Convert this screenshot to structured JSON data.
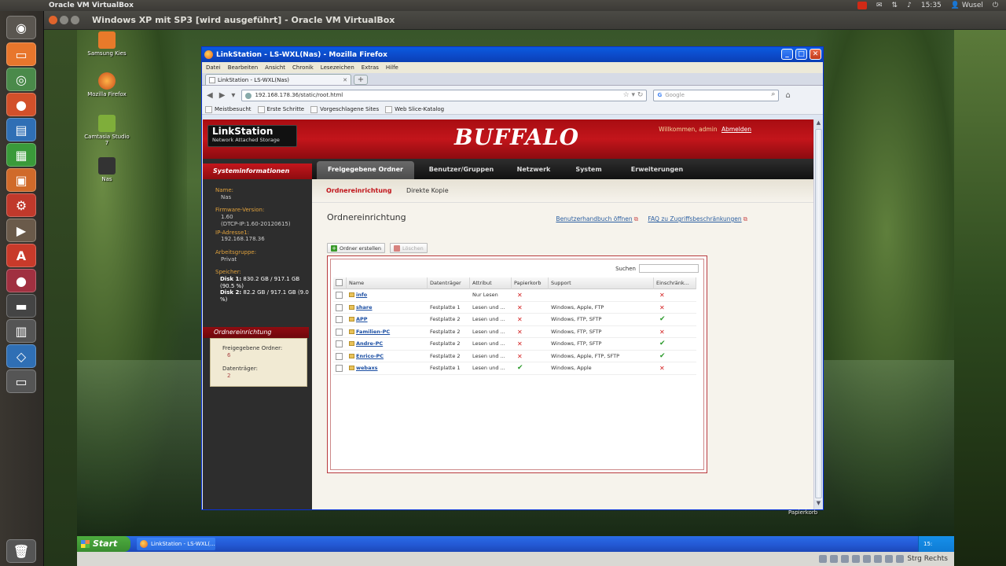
{
  "ubuntu_panel": {
    "app_title": "Oracle VM VirtualBox",
    "time": "15:35",
    "user": "Wusel"
  },
  "launcher": {
    "items": [
      "dash-icon",
      "files-icon",
      "chrome-icon",
      "firefox-icon",
      "writer-icon",
      "calc-icon",
      "impress-icon",
      "settings-icon",
      "app-icon",
      "software-icon",
      "terminal-icon",
      "clapper-icon",
      "virtualbox-icon",
      "window-icon",
      "trash-icon"
    ]
  },
  "vbox": {
    "window_title": "Windows XP mit SP3 [wird ausgeführt] - Oracle VM VirtualBox",
    "status_text": "Strg Rechts"
  },
  "desktop_icons": [
    {
      "label": "Samsung Kies"
    },
    {
      "label": "Mozilla Firefox"
    },
    {
      "label": "Camtasia Studio 7"
    },
    {
      "label": "Nas"
    }
  ],
  "firefox": {
    "window_title": "LinkStation - LS-WXL(Nas) - Mozilla Firefox",
    "menu": [
      "Datei",
      "Bearbeiten",
      "Ansicht",
      "Chronik",
      "Lesezeichen",
      "Extras",
      "Hilfe"
    ],
    "tab_title": "LinkStation - LS-WXL(Nas)",
    "url": "192.168.178.36/static/root.html",
    "search_placeholder": "Google",
    "bookmarks": [
      "Meistbesucht",
      "Erste Schritte",
      "Vorgeschlagene Sites",
      "Web Slice-Katalog"
    ]
  },
  "page": {
    "logo_line1": "LinkStation",
    "logo_line2": "Network Attached Storage",
    "brand": "BUFFALO",
    "welcome": "Willkommen, admin",
    "logout": "Abmelden",
    "nav_tabs": [
      "Freigegebene Ordner",
      "Benutzer/Gruppen",
      "Netzwerk",
      "System",
      "Erweiterungen"
    ],
    "subnav": [
      "Ordnereinrichtung",
      "Direkte Kopie"
    ],
    "sidebar": {
      "title": "Systeminformationen",
      "name_label": "Name:",
      "name_value": "Nas",
      "fw_label": "Firmware-Version:",
      "fw_value1": "1.60",
      "fw_value2": "(DTCP-IP:1.60-20120615)",
      "ip_label": "IP-Adresse1:",
      "ip_value": "192.168.178.36",
      "wg_label": "Arbeitsgruppe:",
      "wg_value": "Privat",
      "mem_label": "Speicher:",
      "disk1_bold": "Disk 1:",
      "disk1_value": "830.2 GB / 917.1 GB (90.5 %)",
      "disk2_bold": "Disk 2:",
      "disk2_value": "82.2 GB / 917.1 GB (9.0 %)",
      "section2_title": "Ordnereinrichtung",
      "shared_label": "Freigegebene Ordner:",
      "shared_value": "6",
      "drives_label": "Datenträger:",
      "drives_value": "2"
    },
    "title": "Ordnereinrichtung",
    "link_manual": "Benutzerhandbuch öffnen",
    "link_faq": "FAQ zu Zugriffsbeschränkungen",
    "btn_create": "Ordner erstellen",
    "btn_delete": "Löschen",
    "search_label": "Suchen",
    "columns": [
      "Name",
      "Datenträger",
      "Attribut",
      "Papierkorb",
      "Support",
      "Einschränk..."
    ],
    "rows": [
      {
        "name": "info",
        "drive": "",
        "attr": "Nur Lesen",
        "trash": "x",
        "support": "",
        "restrict": "x"
      },
      {
        "name": "share",
        "drive": "Festplatte 1",
        "attr": "Lesen und ...",
        "trash": "x",
        "support": "Windows, Apple, FTP",
        "restrict": "x"
      },
      {
        "name": "APP",
        "drive": "Festplatte 2",
        "attr": "Lesen und ...",
        "trash": "x",
        "support": "Windows, FTP, SFTP",
        "restrict": "ok"
      },
      {
        "name": "Familien-PC",
        "drive": "Festplatte 2",
        "attr": "Lesen und ...",
        "trash": "x",
        "support": "Windows, FTP, SFTP",
        "restrict": "x"
      },
      {
        "name": "Andre-PC",
        "drive": "Festplatte 2",
        "attr": "Lesen und ...",
        "trash": "x",
        "support": "Windows, FTP, SFTP",
        "restrict": "ok"
      },
      {
        "name": "Enrico-PC",
        "drive": "Festplatte 2",
        "attr": "Lesen und ...",
        "trash": "x",
        "support": "Windows, Apple, FTP, SFTP",
        "restrict": "ok"
      },
      {
        "name": "webaxs",
        "drive": "Festplatte 1",
        "attr": "Lesen und ...",
        "trash": "ok",
        "support": "Windows, Apple",
        "restrict": "x"
      }
    ]
  },
  "xp_taskbar": {
    "start": "Start",
    "firefox_task": "LinkStation - LS-WXL(...",
    "tray_time": "15:",
    "recycle_label": "Papierkorb"
  },
  "colors": {
    "buffalo_red": "#c3151b",
    "link_blue": "#1c4fa3",
    "xp_blue": "#245ad6"
  }
}
